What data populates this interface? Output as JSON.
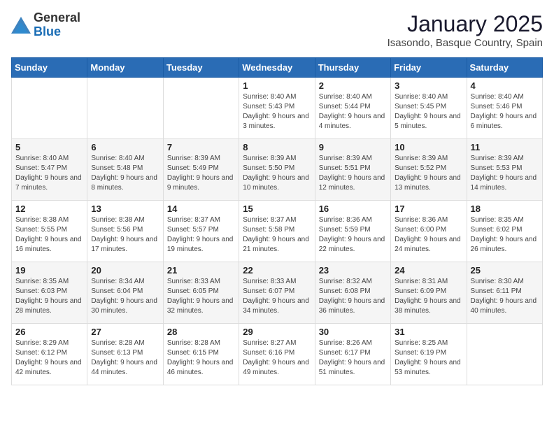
{
  "logo": {
    "general": "General",
    "blue": "Blue"
  },
  "header": {
    "title": "January 2025",
    "subtitle": "Isasondo, Basque Country, Spain"
  },
  "days_of_week": [
    "Sunday",
    "Monday",
    "Tuesday",
    "Wednesday",
    "Thursday",
    "Friday",
    "Saturday"
  ],
  "weeks": [
    [
      {
        "day": "",
        "info": ""
      },
      {
        "day": "",
        "info": ""
      },
      {
        "day": "",
        "info": ""
      },
      {
        "day": "1",
        "info": "Sunrise: 8:40 AM\nSunset: 5:43 PM\nDaylight: 9 hours and 3 minutes."
      },
      {
        "day": "2",
        "info": "Sunrise: 8:40 AM\nSunset: 5:44 PM\nDaylight: 9 hours and 4 minutes."
      },
      {
        "day": "3",
        "info": "Sunrise: 8:40 AM\nSunset: 5:45 PM\nDaylight: 9 hours and 5 minutes."
      },
      {
        "day": "4",
        "info": "Sunrise: 8:40 AM\nSunset: 5:46 PM\nDaylight: 9 hours and 6 minutes."
      }
    ],
    [
      {
        "day": "5",
        "info": "Sunrise: 8:40 AM\nSunset: 5:47 PM\nDaylight: 9 hours and 7 minutes."
      },
      {
        "day": "6",
        "info": "Sunrise: 8:40 AM\nSunset: 5:48 PM\nDaylight: 9 hours and 8 minutes."
      },
      {
        "day": "7",
        "info": "Sunrise: 8:39 AM\nSunset: 5:49 PM\nDaylight: 9 hours and 9 minutes."
      },
      {
        "day": "8",
        "info": "Sunrise: 8:39 AM\nSunset: 5:50 PM\nDaylight: 9 hours and 10 minutes."
      },
      {
        "day": "9",
        "info": "Sunrise: 8:39 AM\nSunset: 5:51 PM\nDaylight: 9 hours and 12 minutes."
      },
      {
        "day": "10",
        "info": "Sunrise: 8:39 AM\nSunset: 5:52 PM\nDaylight: 9 hours and 13 minutes."
      },
      {
        "day": "11",
        "info": "Sunrise: 8:39 AM\nSunset: 5:53 PM\nDaylight: 9 hours and 14 minutes."
      }
    ],
    [
      {
        "day": "12",
        "info": "Sunrise: 8:38 AM\nSunset: 5:55 PM\nDaylight: 9 hours and 16 minutes."
      },
      {
        "day": "13",
        "info": "Sunrise: 8:38 AM\nSunset: 5:56 PM\nDaylight: 9 hours and 17 minutes."
      },
      {
        "day": "14",
        "info": "Sunrise: 8:37 AM\nSunset: 5:57 PM\nDaylight: 9 hours and 19 minutes."
      },
      {
        "day": "15",
        "info": "Sunrise: 8:37 AM\nSunset: 5:58 PM\nDaylight: 9 hours and 21 minutes."
      },
      {
        "day": "16",
        "info": "Sunrise: 8:36 AM\nSunset: 5:59 PM\nDaylight: 9 hours and 22 minutes."
      },
      {
        "day": "17",
        "info": "Sunrise: 8:36 AM\nSunset: 6:00 PM\nDaylight: 9 hours and 24 minutes."
      },
      {
        "day": "18",
        "info": "Sunrise: 8:35 AM\nSunset: 6:02 PM\nDaylight: 9 hours and 26 minutes."
      }
    ],
    [
      {
        "day": "19",
        "info": "Sunrise: 8:35 AM\nSunset: 6:03 PM\nDaylight: 9 hours and 28 minutes."
      },
      {
        "day": "20",
        "info": "Sunrise: 8:34 AM\nSunset: 6:04 PM\nDaylight: 9 hours and 30 minutes."
      },
      {
        "day": "21",
        "info": "Sunrise: 8:33 AM\nSunset: 6:05 PM\nDaylight: 9 hours and 32 minutes."
      },
      {
        "day": "22",
        "info": "Sunrise: 8:33 AM\nSunset: 6:07 PM\nDaylight: 9 hours and 34 minutes."
      },
      {
        "day": "23",
        "info": "Sunrise: 8:32 AM\nSunset: 6:08 PM\nDaylight: 9 hours and 36 minutes."
      },
      {
        "day": "24",
        "info": "Sunrise: 8:31 AM\nSunset: 6:09 PM\nDaylight: 9 hours and 38 minutes."
      },
      {
        "day": "25",
        "info": "Sunrise: 8:30 AM\nSunset: 6:11 PM\nDaylight: 9 hours and 40 minutes."
      }
    ],
    [
      {
        "day": "26",
        "info": "Sunrise: 8:29 AM\nSunset: 6:12 PM\nDaylight: 9 hours and 42 minutes."
      },
      {
        "day": "27",
        "info": "Sunrise: 8:28 AM\nSunset: 6:13 PM\nDaylight: 9 hours and 44 minutes."
      },
      {
        "day": "28",
        "info": "Sunrise: 8:28 AM\nSunset: 6:15 PM\nDaylight: 9 hours and 46 minutes."
      },
      {
        "day": "29",
        "info": "Sunrise: 8:27 AM\nSunset: 6:16 PM\nDaylight: 9 hours and 49 minutes."
      },
      {
        "day": "30",
        "info": "Sunrise: 8:26 AM\nSunset: 6:17 PM\nDaylight: 9 hours and 51 minutes."
      },
      {
        "day": "31",
        "info": "Sunrise: 8:25 AM\nSunset: 6:19 PM\nDaylight: 9 hours and 53 minutes."
      },
      {
        "day": "",
        "info": ""
      }
    ]
  ]
}
